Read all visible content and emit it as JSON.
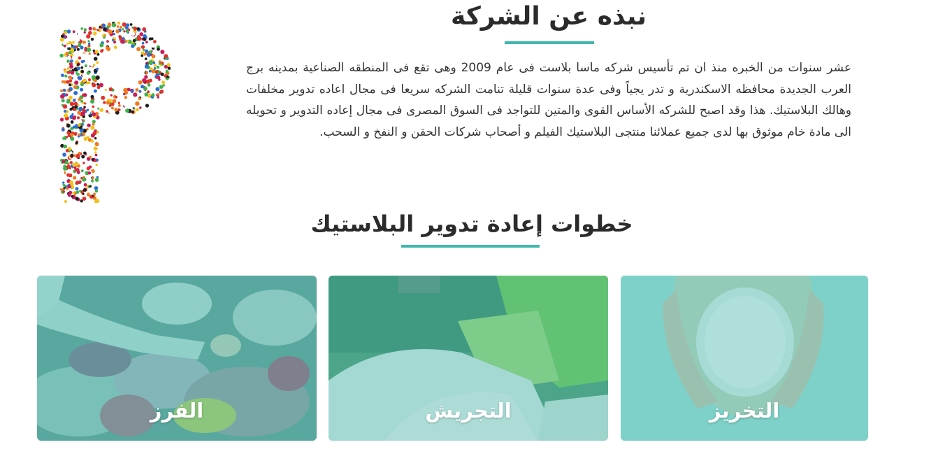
{
  "about": {
    "title": "نبذه عن الشركة",
    "text": "عشر سنوات من الخبره منذ ان تم تأسيس شركه ماسا بلاست فى عام 2009 وهى تقع فى المنطقه الصناعية بمدينه برج العرب الجديدة محافظه الاسكندرية و تدر يجياً وفى عدة سنوات قليلة تنامت الشركه سريعا فى مجال اعاده تدوير مخلفات وهالك البلاستيك. هذا وقد اصبح للشركه الأساس القوى والمتين للتواجد فى السوق المصرى فى مجال إعاده التدوير و تحويله الى مادة خام موثوق بها لدى جميع عملائنا منتجى البلاستيك الفيلم و أصحاب شركات الحقن و النفخ و السحب."
  },
  "steps": {
    "title": "خطوات إعادة تدوير البلاستيك",
    "cards": [
      {
        "label": "الفرز"
      },
      {
        "label": "التجريش"
      },
      {
        "label": "التخريز"
      }
    ]
  },
  "colors": {
    "accent": "#3fb8ae",
    "overlay": "#2fb5a6",
    "text": "#333333"
  }
}
